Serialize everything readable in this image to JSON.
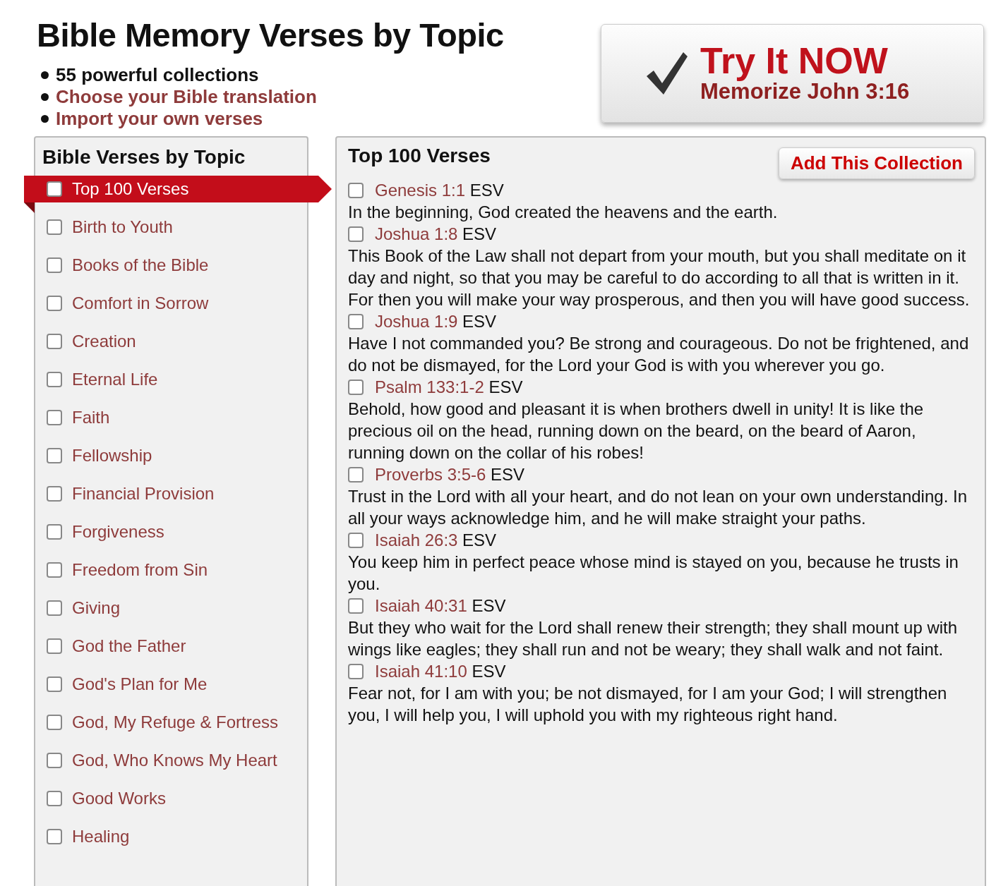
{
  "header": {
    "title": "Bible Memory Verses by Topic",
    "bullets": [
      {
        "text": "55 powerful collections",
        "kind": "plain"
      },
      {
        "text": "Choose your Bible translation",
        "kind": "link"
      },
      {
        "text": "Import your own verses",
        "kind": "link"
      }
    ]
  },
  "cta": {
    "title": "Try It NOW",
    "subtitle": "Memorize John 3:16"
  },
  "sidebar": {
    "title": "Bible Verses by Topic",
    "items": [
      {
        "label": "Top 100 Verses",
        "selected": true,
        "checked": false
      },
      {
        "label": "Birth to Youth",
        "selected": false,
        "checked": false
      },
      {
        "label": "Books of the Bible",
        "selected": false,
        "checked": false
      },
      {
        "label": "Comfort in Sorrow",
        "selected": false,
        "checked": false
      },
      {
        "label": "Creation",
        "selected": false,
        "checked": false
      },
      {
        "label": "Eternal Life",
        "selected": false,
        "checked": false
      },
      {
        "label": "Faith",
        "selected": false,
        "checked": false
      },
      {
        "label": "Fellowship",
        "selected": false,
        "checked": false
      },
      {
        "label": "Financial Provision",
        "selected": false,
        "checked": false
      },
      {
        "label": "Forgiveness",
        "selected": false,
        "checked": false
      },
      {
        "label": "Freedom from Sin",
        "selected": false,
        "checked": false
      },
      {
        "label": "Giving",
        "selected": false,
        "checked": false
      },
      {
        "label": "God the Father",
        "selected": false,
        "checked": false
      },
      {
        "label": "God's Plan for Me",
        "selected": false,
        "checked": false
      },
      {
        "label": "God, My Refuge & Fortress",
        "selected": false,
        "checked": false
      },
      {
        "label": "God, Who Knows My Heart",
        "selected": false,
        "checked": false
      },
      {
        "label": "Good Works",
        "selected": false,
        "checked": false
      },
      {
        "label": "Healing",
        "selected": false,
        "checked": false
      }
    ]
  },
  "collection": {
    "title": "Top 100 Verses",
    "add_button": "Add This Collection",
    "verses": [
      {
        "reference": "Genesis 1:1",
        "translation": "ESV",
        "checked": false,
        "text": "In the beginning, God created the heavens and the earth."
      },
      {
        "reference": "Joshua 1:8",
        "translation": "ESV",
        "checked": false,
        "text": "This Book of the Law shall not depart from your mouth, but you shall meditate on it day and night, so that you may be careful to do according to all that is written in it. For then you will make your way prosperous, and then you will have good success."
      },
      {
        "reference": "Joshua 1:9",
        "translation": "ESV",
        "checked": false,
        "text": "Have I not commanded you? Be strong and courageous. Do not be frightened, and do not be dismayed, for the Lord your God is with you wherever you go."
      },
      {
        "reference": "Psalm 133:1-2",
        "translation": "ESV",
        "checked": false,
        "text": "Behold, how good and pleasant it is when brothers dwell in unity! It is like the precious oil on the head, running down on the beard, on the beard of Aaron, running down on the collar of his robes!"
      },
      {
        "reference": "Proverbs 3:5-6",
        "translation": "ESV",
        "checked": false,
        "text": "Trust in the Lord with all your heart, and do not lean on your own understanding. In all your ways acknowledge him, and he will make straight your paths."
      },
      {
        "reference": "Isaiah 26:3",
        "translation": "ESV",
        "checked": false,
        "text": "You keep him in perfect peace whose mind is stayed on you, because he trusts in you."
      },
      {
        "reference": "Isaiah 40:31",
        "translation": "ESV",
        "checked": false,
        "text": "But they who wait for the Lord shall renew their strength; they shall mount up with wings like eagles; they shall run and not be weary; they shall walk and not faint."
      },
      {
        "reference": "Isaiah 41:10",
        "translation": "ESV",
        "checked": false,
        "text": "Fear not, for I am with you; be not dismayed, for I am your God; I will strengthen you, I will help you, I will uphold you with my righteous right hand."
      }
    ]
  }
}
